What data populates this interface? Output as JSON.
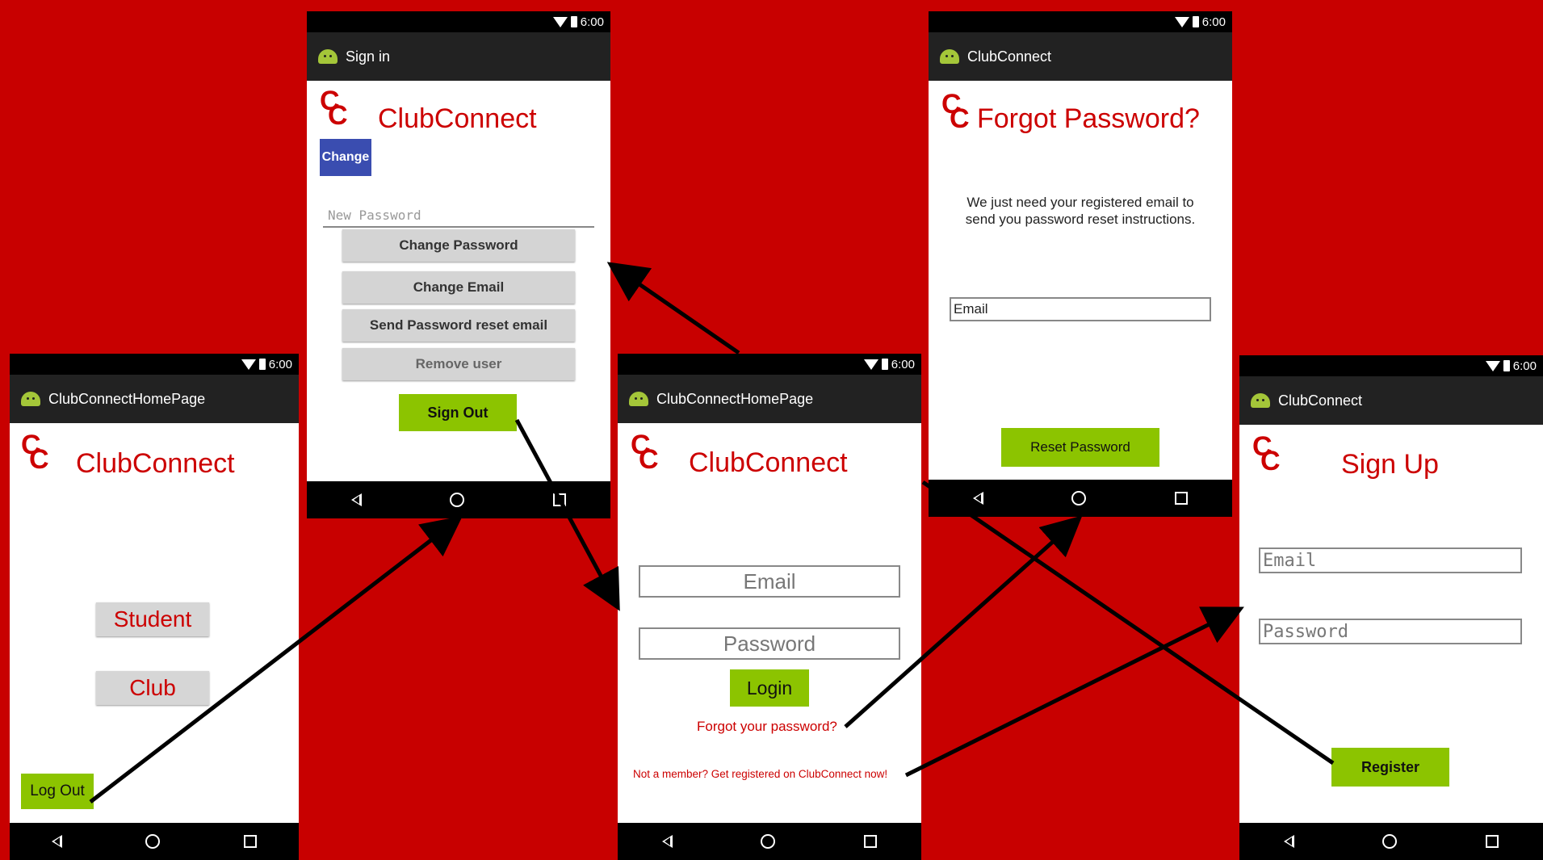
{
  "status": {
    "time": "6:00"
  },
  "home": {
    "app_title": "ClubConnectHomePage",
    "logo": [
      "C",
      "C"
    ],
    "brand": "ClubConnect",
    "student_label": "Student",
    "club_label": "Club",
    "logout_label": "Log Out"
  },
  "signin": {
    "app_title": "Sign in",
    "logo": [
      "C",
      "C"
    ],
    "brand": "ClubConnect",
    "change_label": "Change",
    "field_placeholder": "New Password",
    "buttons": [
      "Change Password",
      "Change Email",
      "Send Password reset email",
      "Remove user"
    ],
    "signout_label": "Sign Out"
  },
  "login": {
    "app_title": "ClubConnectHomePage",
    "logo": [
      "C",
      "C"
    ],
    "brand": "ClubConnect",
    "email_placeholder": "Email",
    "password_placeholder": "Password",
    "login_label": "Login",
    "forgot_link": "Forgot your password?",
    "register_link": "Not a member? Get registered on ClubConnect now!"
  },
  "forgot": {
    "app_title": "ClubConnect",
    "logo": [
      "C",
      "C"
    ],
    "title": "Forgot Password?",
    "instructions_line1": "We just need your registered email to",
    "instructions_line2": "send you password reset instructions.",
    "email_placeholder": "Email",
    "reset_label": "Reset Password"
  },
  "signup": {
    "app_title": "ClubConnect",
    "logo": [
      "C",
      "C"
    ],
    "title": "Sign Up",
    "email_placeholder": "Email",
    "password_placeholder": "Password",
    "register_label": "Register"
  },
  "colors": {
    "background": "#c80000",
    "accent_red": "#cc0000",
    "green_button": "#8cc400",
    "change_button": "#3a4db0",
    "arrow": "#000000"
  }
}
